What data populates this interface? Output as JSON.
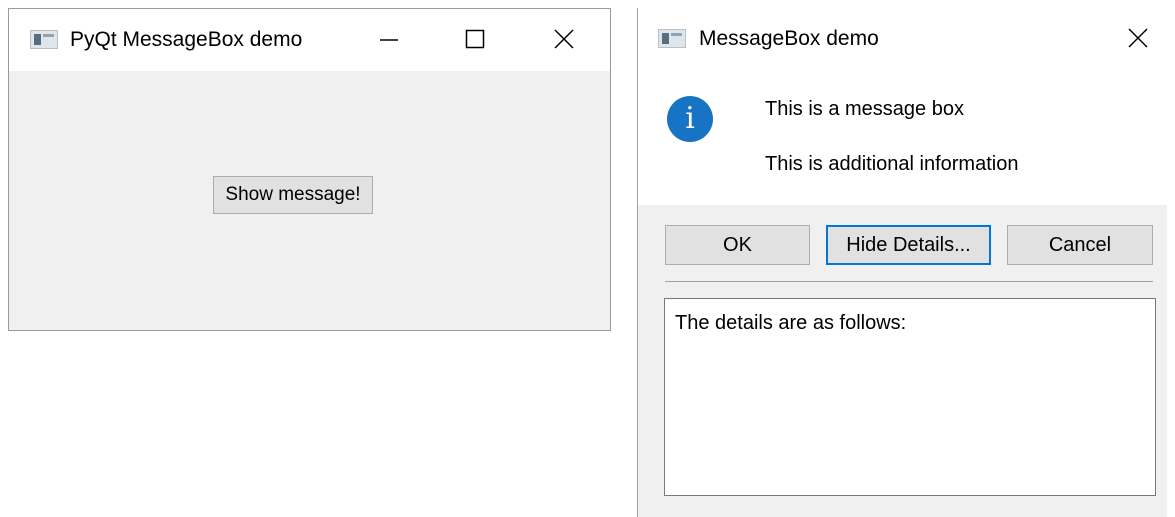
{
  "main_window": {
    "title": "PyQt MessageBox demo",
    "controls": {
      "minimize": "minimize-icon",
      "maximize": "maximize-icon",
      "close": "close-icon"
    },
    "show_button_label": "Show message!"
  },
  "dialog": {
    "title": "MessageBox demo",
    "icon": "information-icon",
    "icon_color": "#1773c4",
    "message": "This is a message box",
    "informative_text": "This is additional information",
    "buttons": {
      "ok": "OK",
      "details": "Hide Details...",
      "cancel": "Cancel"
    },
    "details_text": "The details are as follows:"
  }
}
